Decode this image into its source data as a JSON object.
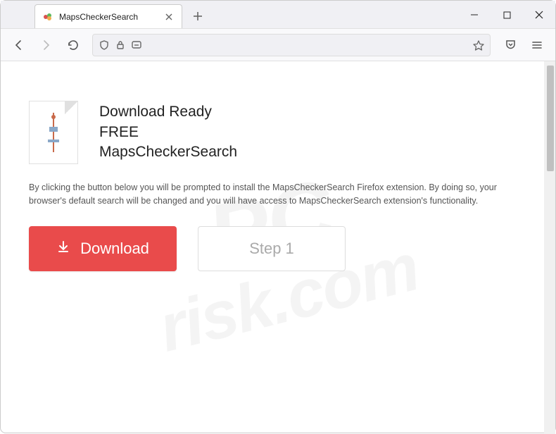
{
  "tab": {
    "title": "MapsCheckerSearch"
  },
  "page": {
    "heading1": "Download Ready",
    "heading2": "FREE",
    "heading3": "MapsCheckerSearch",
    "description": "By clicking the button below you will be prompted to install the MapsCheckerSearch Firefox extension. By doing so, your browser's default search will be changed and you will have access to MapsCheckerSearch extension's functionality.",
    "download_label": "Download",
    "step_label": "Step 1"
  },
  "watermark": {
    "line1": "PC",
    "line2": "risk.com"
  },
  "colors": {
    "primary_button": "#e94b4b"
  }
}
